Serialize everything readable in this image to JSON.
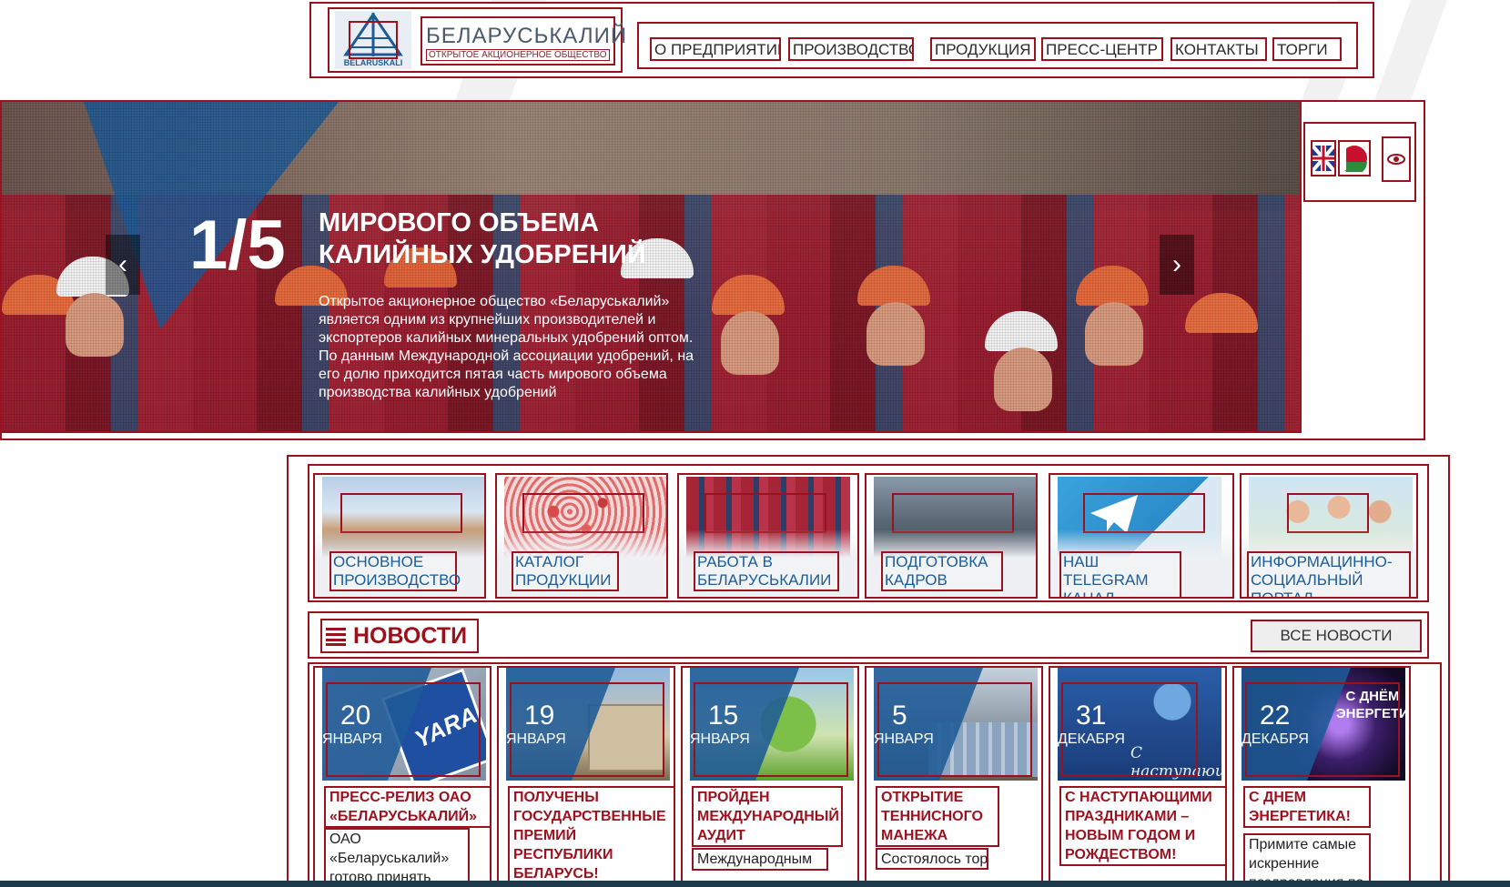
{
  "header": {
    "logo_title": "БЕЛАРУСЬКАЛИЙ",
    "logo_subtitle": "ОТКРЫТОЕ АКЦИОНЕРНОЕ ОБЩЕСТВО",
    "logo_mark_text": "BELARUSKALI",
    "nav": [
      {
        "label": "О ПРЕДПРИЯТИИ"
      },
      {
        "label": "ПРОИЗВОДСТВО"
      },
      {
        "label": "ПРОДУКЦИЯ"
      },
      {
        "label": "ПРЕСС-ЦЕНТР"
      },
      {
        "label": "КОНТАКТЫ"
      },
      {
        "label": "ТОРГИ"
      }
    ]
  },
  "hero": {
    "counter": "1/5",
    "title": "МИРОВОГО ОБЪЕМА КАЛИЙНЫХ УДОБРЕНИЙ",
    "text": "Открытое акционерное общество «Беларуськалий» является одним из крупнейших производителей и экспортеров калийных минеральных удобрений оптом. По данным Международной ассоциации удобрений, на его долю приходится пятая часть мирового объема производства калийных удобрений",
    "prev_icon": "chevron-left-icon",
    "next_icon": "chevron-right-icon"
  },
  "languages": [
    {
      "code": "en",
      "icon": "uk-flag-icon"
    },
    {
      "code": "by",
      "icon": "belarus-flag-icon"
    },
    {
      "code": "vision",
      "icon": "eye-icon"
    }
  ],
  "tiles": [
    {
      "label": "ОСНОВНОЕ ПРОИЗВОДСТВО"
    },
    {
      "label": "КАТАЛОГ ПРОДУКЦИИ"
    },
    {
      "label": "РАБОТА В БЕЛАРУСЬКАЛИИ"
    },
    {
      "label": "ПОДГОТОВКА КАДРОВ"
    },
    {
      "label": "НАШ Telegram КАНАЛ"
    },
    {
      "label": "ИНФОРМАЦИННО-СОЦИАЛЬНЫЙ ПОРТАЛ"
    }
  ],
  "news": {
    "title": "НОВОСТИ",
    "all_label": "ВСЕ НОВОСТИ",
    "items": [
      {
        "day": "20",
        "month": "ЯНВАРЯ",
        "headline": "ПРЕСС-РЕЛИЗ ОАО «БЕЛАРУСЬКАЛИЙ»",
        "lead": "ОАО «Беларуськалий» готово принять"
      },
      {
        "day": "19",
        "month": "ЯНВАРЯ",
        "headline": "ПОЛУЧЕНЫ ГОСУДАРСТВЕННЫЕ ПРЕМИЙ РЕСПУБЛИКИ БЕЛАРУСЬ!",
        "lead": ""
      },
      {
        "day": "15",
        "month": "ЯНВАРЯ",
        "headline": "ПРОЙДЕН МЕЖДУНАРОДНЫЙ АУДИТ",
        "lead": "Международным"
      },
      {
        "day": "5",
        "month": "ЯНВАРЯ",
        "headline": "ОТКРЫТИЕ ТЕННИСНОГО МАНЕЖА",
        "lead": "Состоялось торжественное"
      },
      {
        "day": "31",
        "month": "ДЕКАБРЯ",
        "headline": "С НАСТУПАЮЩИМИ ПРАЗДНИКАМИ – НОВЫМ ГОДОМ И РОЖДЕСТВОМ!",
        "lead": ""
      },
      {
        "day": "22",
        "month": "ДЕКАБРЯ",
        "headline": "С ДНЕМ ЭНЕРГЕТИКА!",
        "lead": "Примите самые искренние поздравления по"
      }
    ],
    "pic_captions": {
      "yara": "YARA",
      "newyear": "С наступающим!",
      "energy": "С ДНЁМ ЭНЕРГЕТИКА"
    }
  },
  "colors": {
    "accent": "#9b111e",
    "brand_blue": "#1e5a96",
    "tile_label": "#1b5c9a"
  }
}
